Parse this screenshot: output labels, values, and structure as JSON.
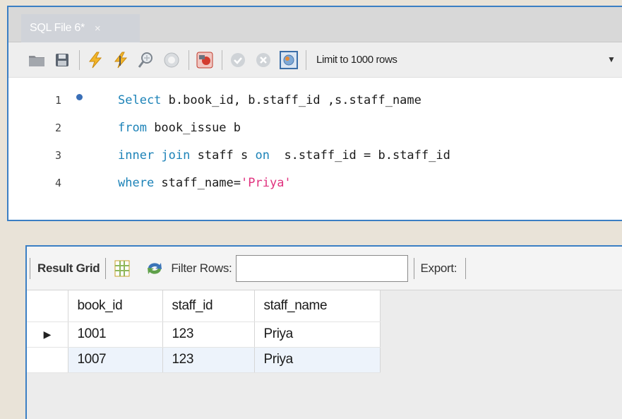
{
  "editor": {
    "tab_label": "SQL File 6*",
    "tab_close": "×",
    "toolbar": {
      "icons": [
        "folder-icon",
        "save-icon",
        "execute-icon",
        "execute-statement-icon",
        "explain-icon",
        "stop-icon",
        "toggle-error-icon",
        "commit-icon",
        "rollback-icon",
        "autocommit-icon"
      ],
      "limit_label": "Limit to 1000 rows"
    },
    "lines": [
      {
        "num": "1",
        "parts": [
          {
            "t": "Select",
            "c": "kw"
          },
          {
            "t": " b.book_id, b.staff_id ,s.staff_name",
            "c": ""
          }
        ]
      },
      {
        "num": "2",
        "parts": [
          {
            "t": "from",
            "c": "kw"
          },
          {
            "t": " book_issue b",
            "c": ""
          }
        ]
      },
      {
        "num": "3",
        "parts": [
          {
            "t": "inner join",
            "c": "kw"
          },
          {
            "t": " staff s ",
            "c": ""
          },
          {
            "t": "on",
            "c": "kw"
          },
          {
            "t": "  s.staff_id = b.staff_id",
            "c": ""
          }
        ]
      },
      {
        "num": "4",
        "parts": [
          {
            "t": "where",
            "c": "kw"
          },
          {
            "t": " staff_name=",
            "c": ""
          },
          {
            "t": "'Priya'",
            "c": "str"
          }
        ]
      }
    ]
  },
  "result": {
    "result_grid_label": "Result Grid",
    "filter_label": "Filter Rows:",
    "filter_value": "",
    "export_label": "Export:",
    "columns": [
      "book_id",
      "staff_id",
      "staff_name"
    ],
    "rows": [
      [
        "1001",
        "123",
        "Priya"
      ],
      [
        "1007",
        "123",
        "Priya"
      ]
    ]
  },
  "colors": {
    "keyword": "#1d83b8",
    "string": "#e0317e",
    "panel_border": "#3b7fc4"
  }
}
